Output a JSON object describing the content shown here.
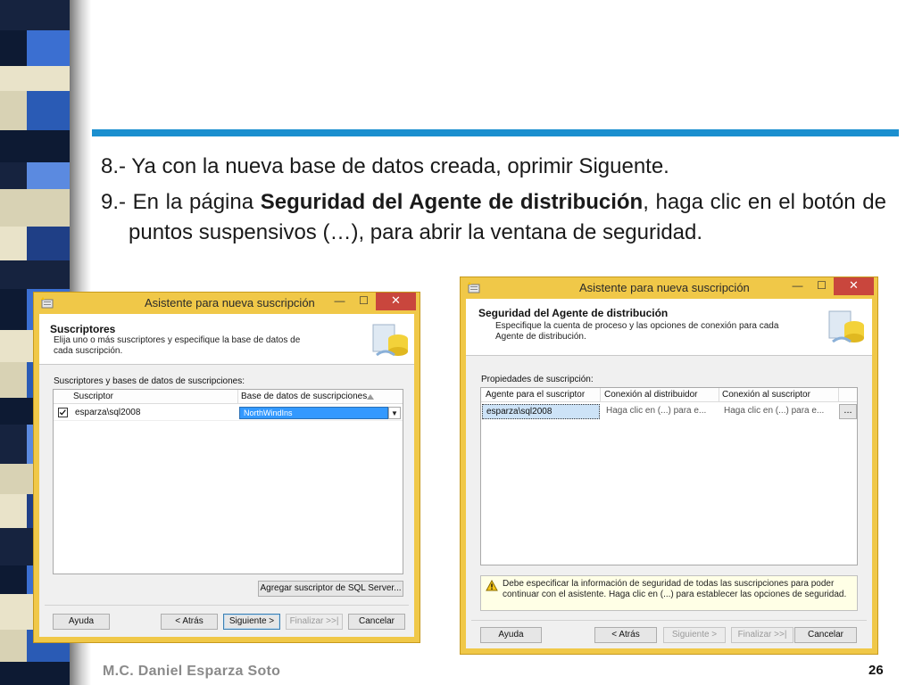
{
  "slide": {
    "step8": "8.- Ya con la nueva base de datos creada, oprimir Siguente.",
    "step9_prefix": "9.- En la página ",
    "step9_bold": "Seguridad del Agente de distribución",
    "step9_suffix": ", haga clic en el botón de puntos suspensivos (…), para abrir la ventana de seguridad.",
    "footer_author": "M.C. Daniel Esparza Soto",
    "page_number": "26"
  },
  "dialog1": {
    "title": "Asistente para nueva suscripción",
    "header_title": "Suscriptores",
    "header_desc": "Elija uno o más suscriptores y especifique la base de datos de cada suscripción.",
    "grid_label": "Suscriptores y bases de datos de suscripciones:",
    "columns": [
      "Suscriptor",
      "Base de datos de suscripciones"
    ],
    "row": {
      "checked": true,
      "subscriber": "esparza\\sql2008",
      "database": "NorthWindIns"
    },
    "add_button": "Agregar suscriptor de SQL Server...",
    "buttons": {
      "help": "Ayuda",
      "back": "< Atrás",
      "next": "Siguiente >",
      "finish": "Finalizar >>|",
      "cancel": "Cancelar"
    }
  },
  "dialog2": {
    "title": "Asistente para nueva suscripción",
    "header_title": "Seguridad del Agente de distribución",
    "header_desc": "Especifique la cuenta de proceso y las opciones de conexión para cada Agente de distribución.",
    "grid_label": "Propiedades de suscripción:",
    "columns": [
      "Agente para el suscriptor",
      "Conexión al distribuidor",
      "Conexión al suscriptor"
    ],
    "row": {
      "agent": "esparza\\sql2008",
      "distributor": "Haga clic en (...) para e...",
      "subscriber": "Haga clic en (...) para e...",
      "ellipsis": "..."
    },
    "warning": "Debe especificar la información de seguridad de todas las suscripciones para poder continuar con el asistente. Haga clic en (...) para establecer las opciones de seguridad.",
    "buttons": {
      "help": "Ayuda",
      "back": "< Atrás",
      "next": "Siguiente >",
      "finish": "Finalizar >>|",
      "cancel": "Cancelar"
    }
  },
  "colors": {
    "accent_bar": "#1b8fcf",
    "window_frame": "#f0c848",
    "close_button": "#c9463d",
    "selection": "#3399ff"
  },
  "icons": [
    "wizard-app-icon",
    "minimize-icon",
    "maximize-icon",
    "close-icon",
    "database-art-icon",
    "sort-up-icon",
    "chevron-down-icon",
    "warning-icon",
    "checkbox-checked-icon"
  ]
}
